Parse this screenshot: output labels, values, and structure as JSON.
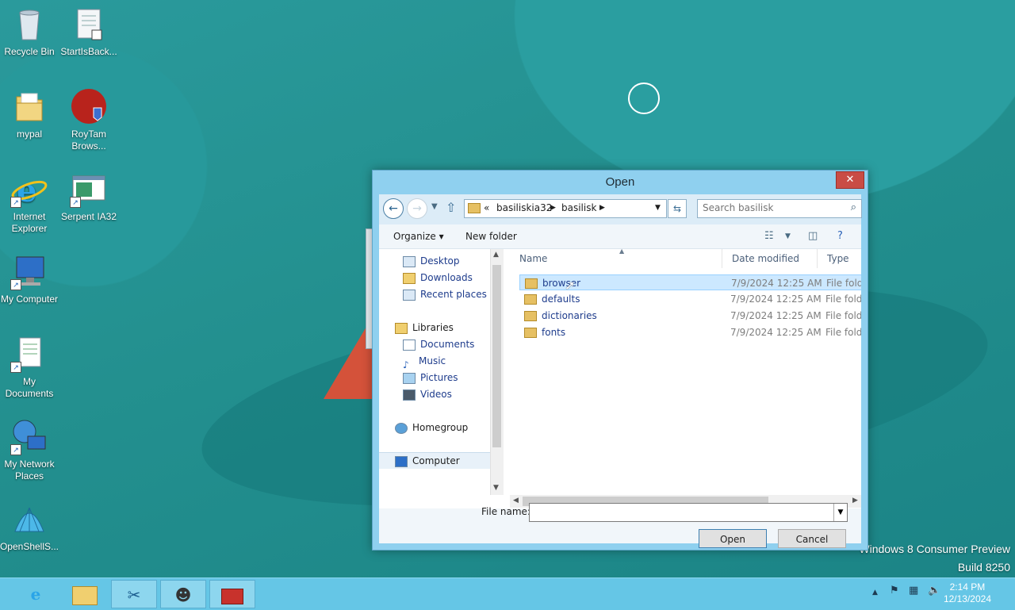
{
  "desktop": {
    "icons": [
      {
        "label": "Recycle Bin",
        "icon": "recycle-bin-icon"
      },
      {
        "label": "StartIsBack...",
        "icon": "startisback-icon"
      },
      {
        "label": "mypal",
        "icon": "folder-icon"
      },
      {
        "label": "RoyTam Brows...",
        "icon": "roytam-browser-icon"
      },
      {
        "label": "Internet Explorer",
        "icon": "internet-explorer-icon"
      },
      {
        "label": "Serpent IA32",
        "icon": "serpent-icon"
      },
      {
        "label": "My Computer",
        "icon": "my-computer-icon"
      },
      {
        "label": "My Documents",
        "icon": "my-documents-icon"
      },
      {
        "label": "My Network Places",
        "icon": "network-places-icon"
      },
      {
        "label": "OpenShellS...",
        "icon": "openshell-icon"
      }
    ],
    "watermark_line1": "Windows 8 Consumer Preview",
    "watermark_line2": "Build 8250"
  },
  "dialog": {
    "title": "Open",
    "close_label": "✕",
    "address": {
      "chevrons": "«",
      "parts": [
        "basiliskia32",
        "basilisk"
      ]
    },
    "search_placeholder": "Search basilisk",
    "toolbar": {
      "organize": "Organize ▾",
      "new_folder": "New folder"
    },
    "nav_pane": {
      "favorites": [
        "Desktop",
        "Downloads",
        "Recent places"
      ],
      "libraries_header": "Libraries",
      "libraries": [
        "Documents",
        "Music",
        "Pictures",
        "Videos"
      ],
      "homegroup": "Homegroup",
      "computer": "Computer"
    },
    "columns": {
      "name": "Name",
      "date": "Date modified",
      "type": "Type"
    },
    "files": [
      {
        "name": "browser",
        "date": "7/9/2024 12:25 AM",
        "type": "File folder"
      },
      {
        "name": "defaults",
        "date": "7/9/2024 12:25 AM",
        "type": "File folder"
      },
      {
        "name": "dictionaries",
        "date": "7/9/2024 12:25 AM",
        "type": "File folder"
      },
      {
        "name": "fonts",
        "date": "7/9/2024 12:25 AM",
        "type": "File folder"
      }
    ],
    "file_name_label": "File name:",
    "file_name_value": "",
    "open_label": "Open",
    "cancel_label": "Cancel"
  },
  "taskbar": {
    "clock_time": "2:14 PM",
    "clock_date": "12/13/2024"
  },
  "colors": {
    "taskbar": "#65c6e6",
    "desktop": "#1e8a8c",
    "close": "#c94c45"
  }
}
